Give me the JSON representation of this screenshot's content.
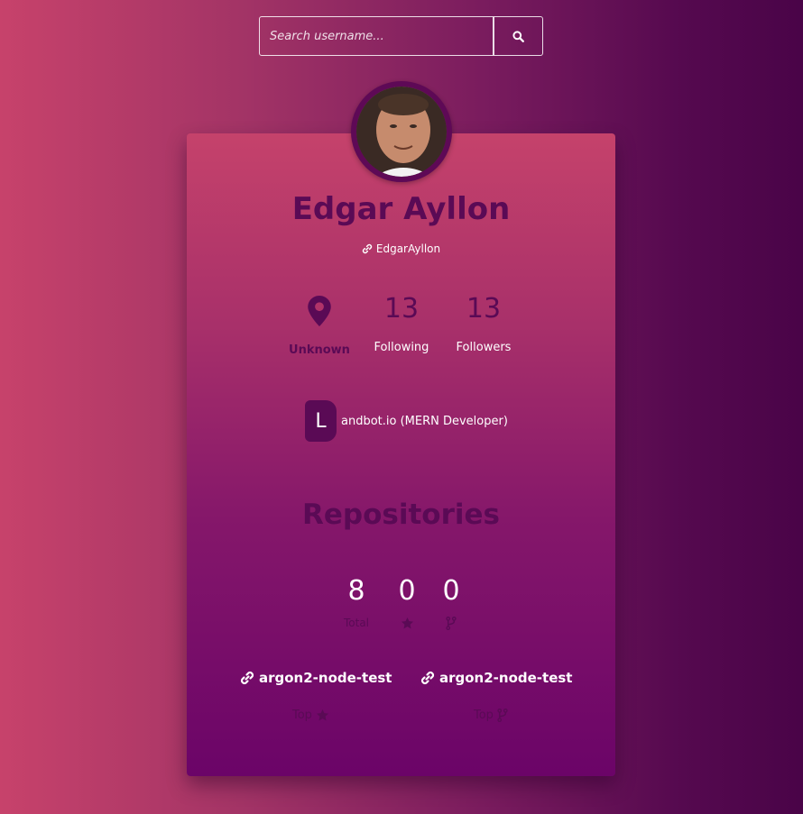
{
  "search": {
    "placeholder": "Search username..."
  },
  "icons": {
    "search": "search-icon",
    "link": "link-icon",
    "location": "map-marker-icon",
    "star": "star-icon",
    "fork": "code-fork-icon"
  },
  "profile": {
    "name": "Edgar Ayllon",
    "username": "EdgarAyllon",
    "location": "Unknown",
    "following_count": "13",
    "following_label": "Following",
    "followers_count": "13",
    "followers_label": "Followers",
    "company_initial": "L",
    "company": "andbot.io (MERN Developer)"
  },
  "repositories": {
    "title": "Repositories",
    "total": "8",
    "total_label": "Total",
    "stars": "0",
    "forks": "0",
    "top_starred": {
      "name": "argon2-node-test",
      "label": "Top"
    },
    "top_forked": {
      "name": "argon2-node-test",
      "label": "Top"
    }
  },
  "colors": {
    "accent": "#5a0a55",
    "gradient_start": "#c7426b",
    "gradient_end": "#4a0448"
  }
}
